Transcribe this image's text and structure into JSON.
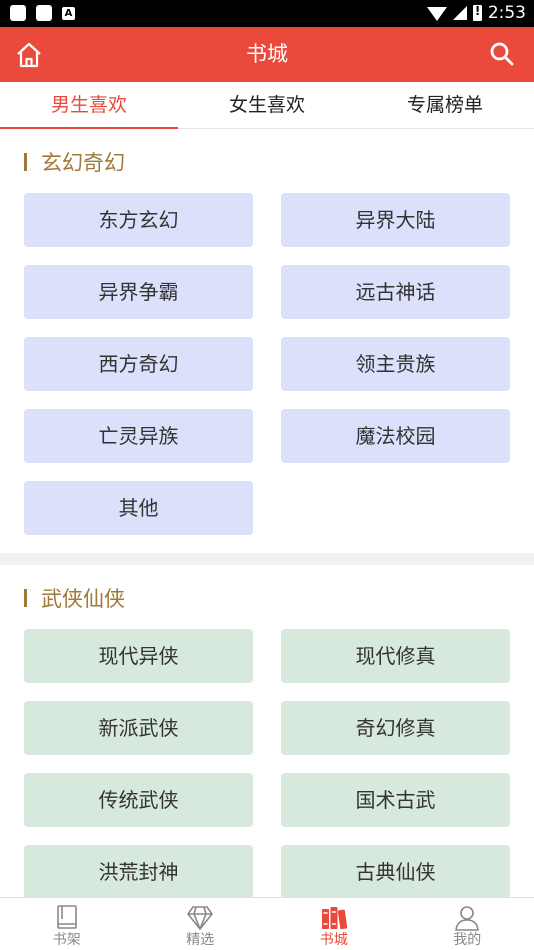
{
  "status_bar": {
    "time": "2:53",
    "icons": [
      "notification-icon",
      "store-icon",
      "a-icon",
      "wifi-icon",
      "signal-icon",
      "battery-icon"
    ]
  },
  "header": {
    "title": "书城",
    "left_icon": "home-icon",
    "right_icon": "search-icon"
  },
  "tabs": [
    {
      "label": "男生喜欢",
      "active": true
    },
    {
      "label": "女生喜欢",
      "active": false
    },
    {
      "label": "专属榜单",
      "active": false
    }
  ],
  "sections": [
    {
      "title": "玄幻奇幻",
      "tags": [
        "东方玄幻",
        "异界大陆",
        "异界争霸",
        "远古神话",
        "西方奇幻",
        "领主贵族",
        "亡灵异族",
        "魔法校园",
        "其他"
      ]
    },
    {
      "title": "武侠仙侠",
      "tags": [
        "现代异侠",
        "现代修真",
        "新派武侠",
        "奇幻修真",
        "传统武侠",
        "国术古武",
        "洪荒封神",
        "古典仙侠"
      ]
    }
  ],
  "bottom_nav": [
    {
      "label": "书架",
      "icon": "bookshelf-icon",
      "active": false
    },
    {
      "label": "精选",
      "icon": "diamond-icon",
      "active": false
    },
    {
      "label": "书城",
      "icon": "books-icon",
      "active": true
    },
    {
      "label": "我的",
      "icon": "user-icon",
      "active": false
    }
  ],
  "colors": {
    "accent": "#e94a3c",
    "section_title": "#a0793a",
    "tag_blue": "#dbe0fb",
    "tag_green": "#d7e8dd"
  }
}
